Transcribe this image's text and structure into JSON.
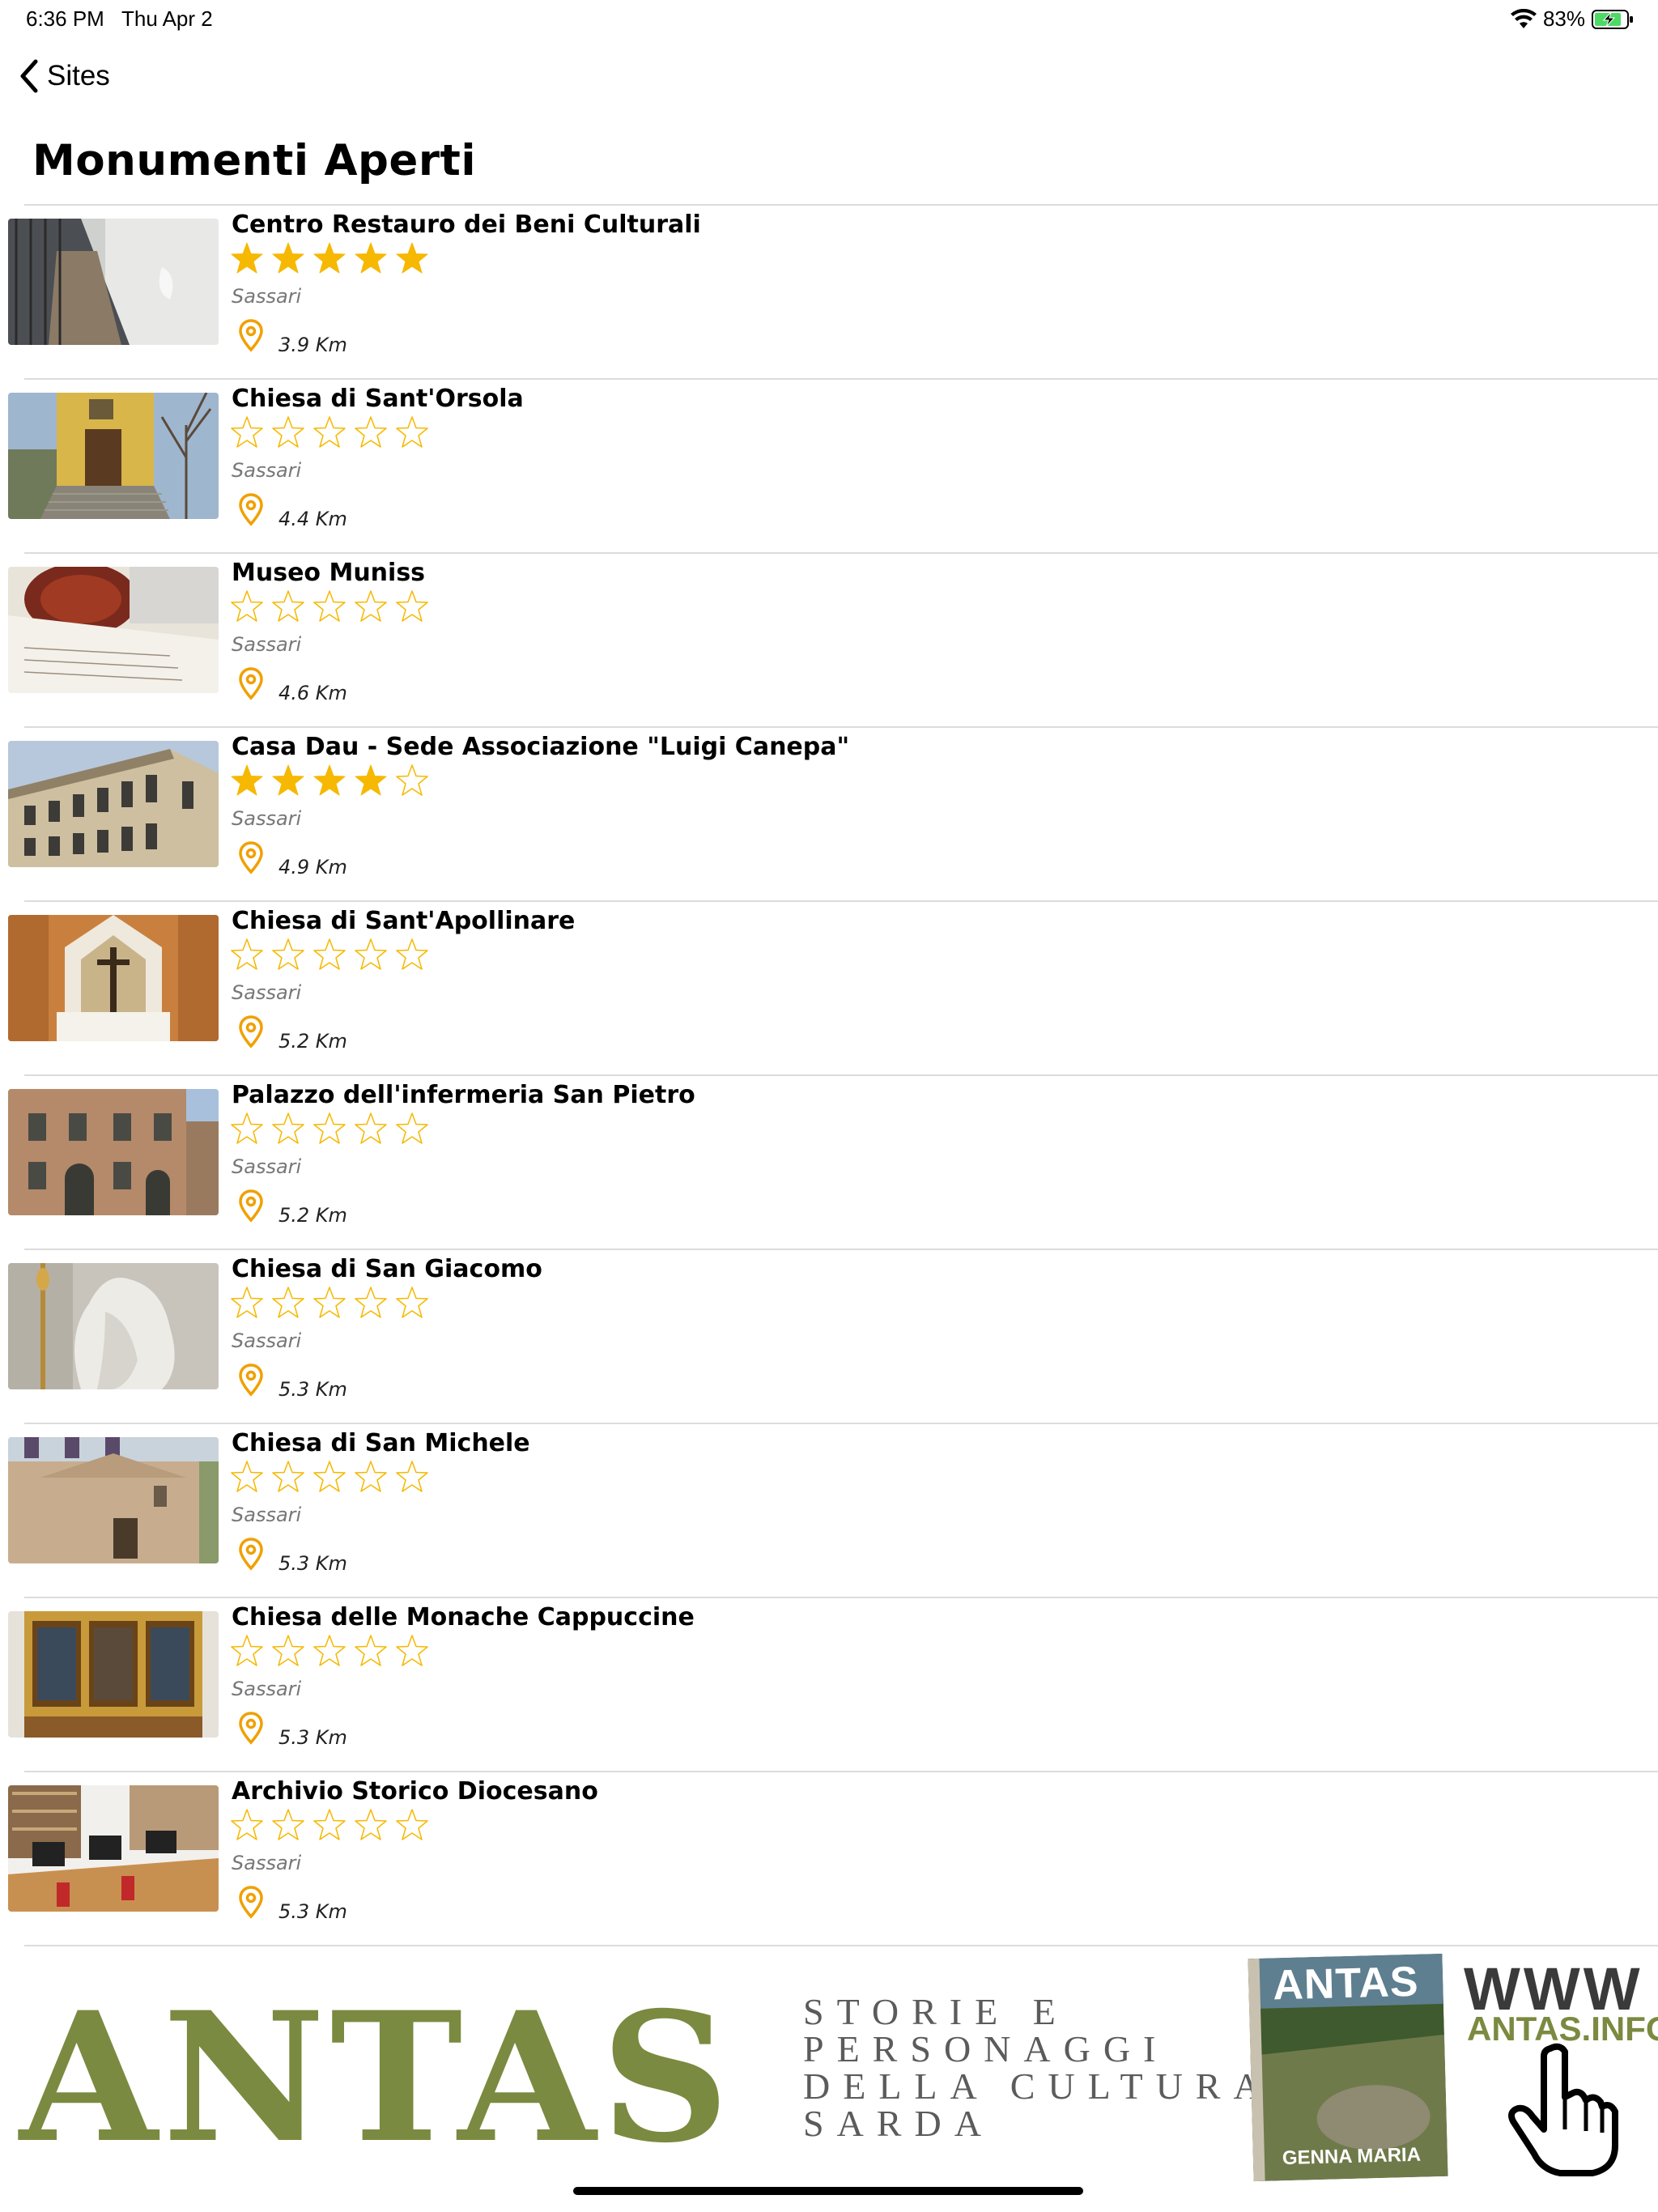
{
  "status_bar": {
    "time": "6:36 PM",
    "date": "Thu Apr 2",
    "battery": "83%"
  },
  "nav": {
    "back_label": "Sites"
  },
  "title": "Monumenti Aperti",
  "colors": {
    "star": "#f6b800",
    "pin": "#f0a000",
    "banner_green": "#7a8a40"
  },
  "items": [
    {
      "name": "Centro Restauro dei Beni Culturali",
      "rating": 5,
      "city": "Sassari",
      "distance": "3.9 Km",
      "thumb": "corridor"
    },
    {
      "name": "Chiesa di Sant'Orsola",
      "rating": 0,
      "city": "Sassari",
      "distance": "4.4 Km",
      "thumb": "yellow-church"
    },
    {
      "name": "Museo Muniss",
      "rating": 0,
      "city": "Sassari",
      "distance": "4.6 Km",
      "thumb": "ceramic"
    },
    {
      "name": "Casa Dau - Sede Associazione \"Luigi Canepa\"",
      "rating": 4,
      "city": "Sassari",
      "distance": "4.9 Km",
      "thumb": "palazzo"
    },
    {
      "name": "Chiesa di Sant'Apollinare",
      "rating": 0,
      "city": "Sassari",
      "distance": "5.2 Km",
      "thumb": "altar"
    },
    {
      "name": "Palazzo dell'infermeria San Pietro",
      "rating": 0,
      "city": "Sassari",
      "distance": "5.2 Km",
      "thumb": "brick-palazzo"
    },
    {
      "name": "Chiesa di San Giacomo",
      "rating": 0,
      "city": "Sassari",
      "distance": "5.3 Km",
      "thumb": "statue"
    },
    {
      "name": "Chiesa di San Michele",
      "rating": 0,
      "city": "Sassari",
      "distance": "5.3 Km",
      "thumb": "facade"
    },
    {
      "name": "Chiesa delle Monache Cappuccine",
      "rating": 0,
      "city": "Sassari",
      "distance": "5.3 Km",
      "thumb": "gold-altar"
    },
    {
      "name": "Archivio Storico Diocesano",
      "rating": 0,
      "city": "Sassari",
      "distance": "5.3 Km",
      "thumb": "library"
    }
  ],
  "banner": {
    "logo": "ANTAS",
    "tagline": [
      "STORIE E",
      "PERSONAGGI",
      "DELLA CULTURA",
      "SARDA"
    ],
    "magazine_title": "ANTAS",
    "magazine_subtitle": "GENNA MARIA",
    "www": "WWW",
    "domain": "ANTAS.INFO"
  }
}
